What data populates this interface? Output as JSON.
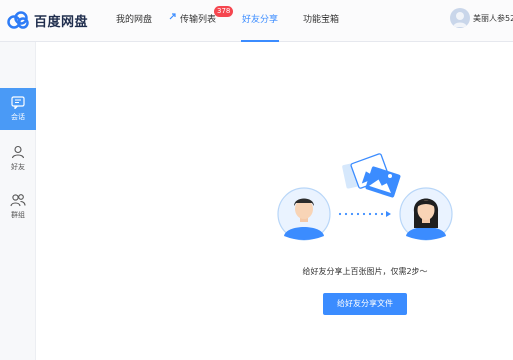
{
  "app": {
    "logo_text": "百度网盘"
  },
  "nav": {
    "items": [
      {
        "label": "我的网盘"
      },
      {
        "label": "传输列表"
      },
      {
        "label": "好友分享"
      },
      {
        "label": "功能宝箱"
      }
    ],
    "transfer_badge": "378",
    "active": "好友分享"
  },
  "user": {
    "name": "美丽人参52"
  },
  "sidebar": {
    "items": [
      {
        "label": "会话",
        "icon": "chat-icon",
        "active": true
      },
      {
        "label": "好友",
        "icon": "person-icon",
        "active": false
      },
      {
        "label": "群组",
        "icon": "group-icon",
        "active": false
      }
    ]
  },
  "main": {
    "hint_text": "给好友分享上百张图片，仅需2步～",
    "share_button_label": "给好友分享文件"
  },
  "colors": {
    "accent": "#3b8cff",
    "badge": "#f5464f",
    "sidebar_active": "#4a9af6"
  }
}
